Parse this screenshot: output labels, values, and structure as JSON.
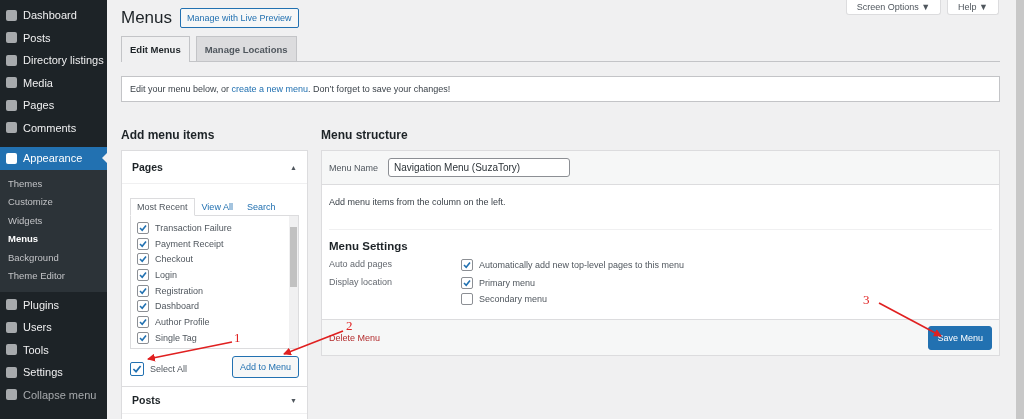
{
  "sidebar": {
    "items": [
      {
        "label": "Dashboard",
        "selected": false
      },
      {
        "label": "Posts",
        "selected": false
      },
      {
        "label": "Directory listings",
        "selected": false
      },
      {
        "label": "Media",
        "selected": false
      },
      {
        "label": "Pages",
        "selected": false
      },
      {
        "label": "Comments",
        "selected": false
      },
      {
        "label": "Appearance",
        "selected": true,
        "children": [
          {
            "label": "Themes",
            "selected": false
          },
          {
            "label": "Customize",
            "selected": false
          },
          {
            "label": "Widgets",
            "selected": false
          },
          {
            "label": "Menus",
            "selected": true
          },
          {
            "label": "Background",
            "selected": false
          },
          {
            "label": "Theme Editor",
            "selected": false
          }
        ]
      },
      {
        "label": "Plugins",
        "selected": false
      },
      {
        "label": "Users",
        "selected": false
      },
      {
        "label": "Tools",
        "selected": false
      },
      {
        "label": "Settings",
        "selected": false
      },
      {
        "label": "Collapse menu",
        "selected": false
      }
    ]
  },
  "header": {
    "title": "Menus",
    "preview_button": "Manage with Live Preview",
    "screen_options": "Screen Options ▼",
    "help": "Help ▼"
  },
  "tabs": [
    {
      "label": "Edit Menus",
      "selected": true
    },
    {
      "label": "Manage Locations",
      "selected": false
    }
  ],
  "notice": {
    "before": "Edit your menu below, or ",
    "link": "create a new menu",
    "after": ". Don’t forget to save your changes!"
  },
  "add_items": {
    "heading": "Add menu items",
    "pages": {
      "title": "Pages",
      "toggle": "▲",
      "expanded": true,
      "tabs": [
        {
          "label": "Most Recent",
          "selected": true
        },
        {
          "label": "View All",
          "selected": false
        },
        {
          "label": "Search",
          "selected": false
        }
      ],
      "items": [
        {
          "label": "Transaction Failure",
          "checked": true
        },
        {
          "label": "Payment Receipt",
          "checked": true
        },
        {
          "label": "Checkout",
          "checked": true
        },
        {
          "label": "Login",
          "checked": true
        },
        {
          "label": "Registration",
          "checked": true
        },
        {
          "label": "Dashboard",
          "checked": true
        },
        {
          "label": "Author Profile",
          "checked": true
        },
        {
          "label": "Single Tag",
          "checked": true
        }
      ],
      "select_all": {
        "label": "Select All",
        "checked": true
      },
      "add_button": "Add to Menu"
    },
    "posts": {
      "title": "Posts",
      "toggle": "▼",
      "expanded": false
    }
  },
  "structure": {
    "heading": "Menu structure",
    "name_label": "Menu Name",
    "name_value": "Navigation Menu (SuzaTory)",
    "hint": "Add menu items from the column on the left.",
    "settings_heading": "Menu Settings",
    "settings": [
      {
        "label": "Auto add pages",
        "options": [
          {
            "label": "Automatically add new top-level pages to this menu",
            "checked": true
          }
        ]
      },
      {
        "label": "Display location",
        "options": [
          {
            "label": "Primary menu",
            "checked": true
          },
          {
            "label": "Secondary menu",
            "checked": false
          }
        ]
      }
    ],
    "delete": "Delete Menu",
    "save": "Save Menu"
  },
  "annotations": [
    "1",
    "2",
    "3"
  ]
}
